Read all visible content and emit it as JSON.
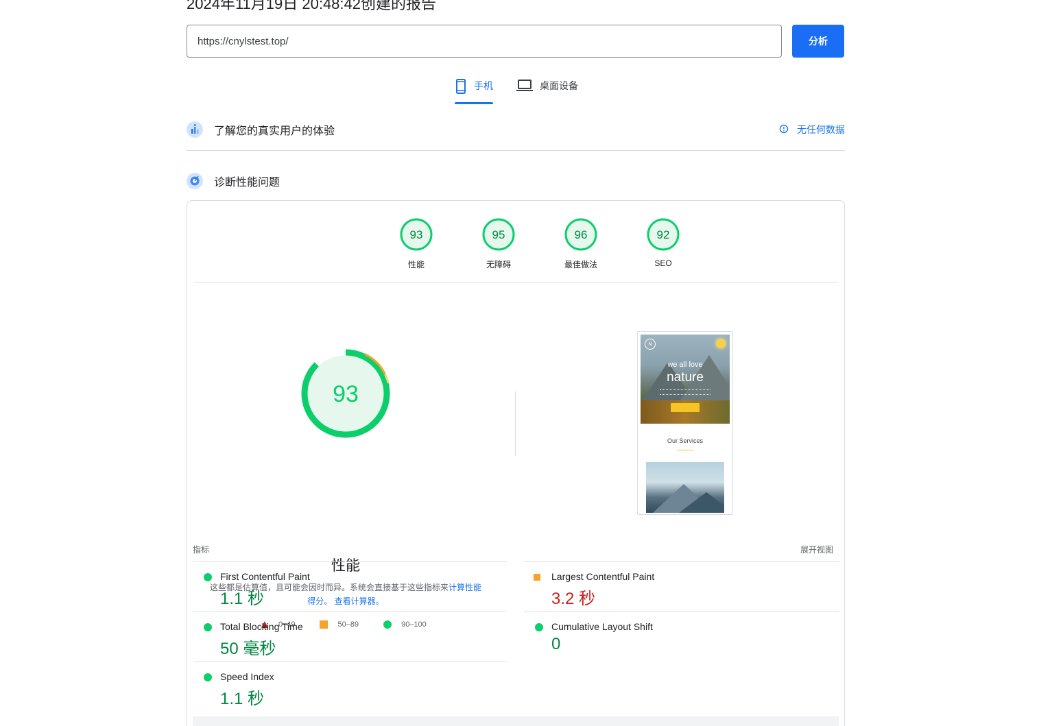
{
  "report": {
    "title": "2024年11月19日 20:48:42创建的报告"
  },
  "search": {
    "url": "https://cnylstest.top/",
    "analyze_label": "分析"
  },
  "tabs": [
    {
      "label": "手机",
      "icon": "mobile-icon",
      "active": true
    },
    {
      "label": "桌面设备",
      "icon": "laptop-icon",
      "active": false
    }
  ],
  "crux": {
    "title": "了解您的真实用户的体验",
    "no_data_label": "无任何数据"
  },
  "diagnose": {
    "title": "诊断性能问题"
  },
  "categories": [
    {
      "score": "93",
      "label": "性能"
    },
    {
      "score": "95",
      "label": "无障碍"
    },
    {
      "score": "96",
      "label": "最佳做法"
    },
    {
      "score": "92",
      "label": "SEO"
    }
  ],
  "performance": {
    "score": "93",
    "title": "性能",
    "desc_text": "这些都是估算值，且可能会因时而异。系统会直接基于这些指标来",
    "desc_link1": "计算性能得分",
    "desc_mid": "。",
    "desc_link2": "查看计算器。"
  },
  "legend": [
    {
      "range": "0–49",
      "shape": "triangle",
      "color": "#c5221f"
    },
    {
      "range": "50–89",
      "shape": "square",
      "color": "#f4a429"
    },
    {
      "range": "90–100",
      "shape": "circle",
      "color": "#0cce6b"
    }
  ],
  "screenshot": {
    "hero_line1": "we all love",
    "hero_line2": "nature",
    "services_title": "Our Services"
  },
  "metrics_section": {
    "label": "指标",
    "expand_label": "展开视图"
  },
  "metrics": [
    {
      "name": "First Contentful Paint",
      "value": "1.1 秒",
      "status": "good"
    },
    {
      "name": "Largest Contentful Paint",
      "value": "3.2 秒",
      "status": "average"
    },
    {
      "name": "Total Blocking Time",
      "value": "50 毫秒",
      "status": "good"
    },
    {
      "name": "Cumulative Layout Shift",
      "value": "0",
      "status": "good"
    },
    {
      "name": "Speed Index",
      "value": "1.1 秒",
      "status": "good"
    }
  ],
  "colors": {
    "accent": "#1a73e8",
    "button": "#1a6ef5",
    "good": "#0cce6b",
    "average": "#f4a429",
    "poor": "#c5221f"
  }
}
